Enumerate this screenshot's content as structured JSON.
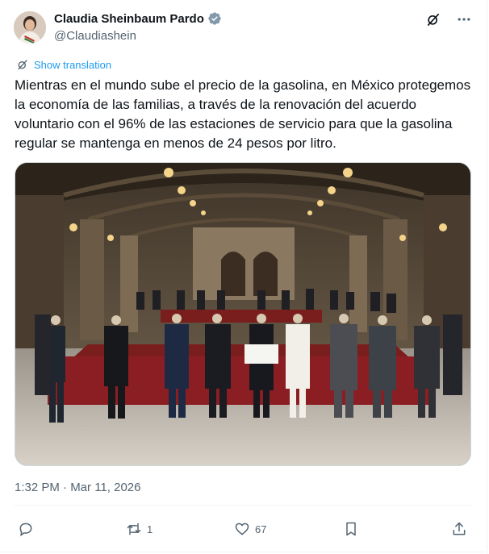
{
  "author": {
    "name": "Claudia Sheinbaum Pardo",
    "handle": "@Claudiashein"
  },
  "translate": {
    "label": "Show translation"
  },
  "tweet": {
    "text": "Mientras en el mundo sube el precio de la gasolina, en México protegemos la economía de las familias, a través de la renovación del acuerdo voluntario con el 96% de las estaciones de servicio para que la gasolina regular se mantenga en menos de 24 pesos por litro.",
    "timestamp": "1:32 PM · Mar 11, 2026"
  },
  "actions": {
    "reposts": "1",
    "likes": "67"
  },
  "colors": {
    "accent": "#1d9bf0",
    "secondary_text": "#536471",
    "verified_badge": "#829aab"
  },
  "icons": [
    "verified-icon",
    "grok-icon",
    "more-icon",
    "translate-icon",
    "reply-icon",
    "repost-icon",
    "like-icon",
    "bookmark-icon",
    "share-icon"
  ]
}
